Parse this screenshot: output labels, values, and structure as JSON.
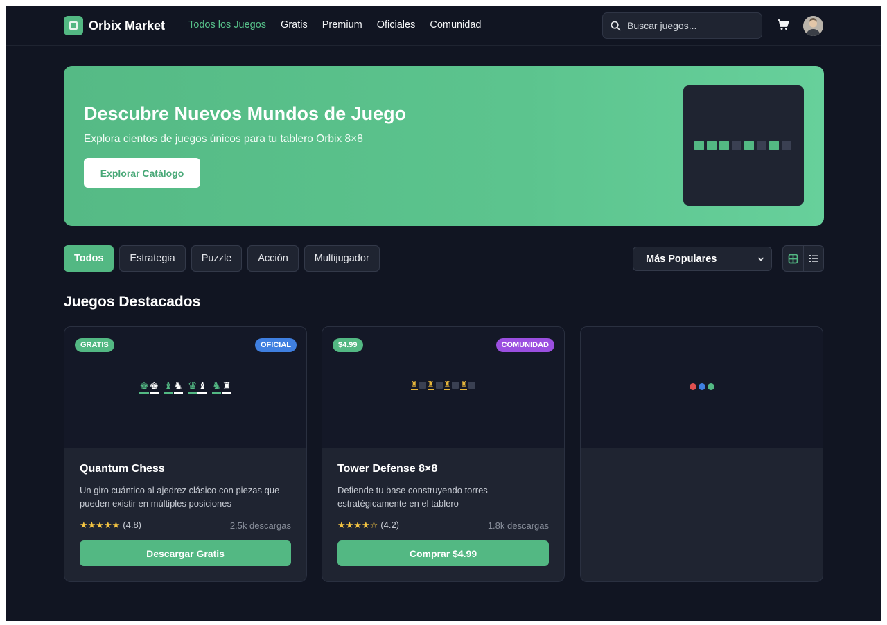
{
  "brand": {
    "name": "Orbix Market",
    "accent": "#53b883"
  },
  "nav": {
    "items": [
      {
        "label": "Todos los Juegos",
        "active": true
      },
      {
        "label": "Gratis",
        "active": false
      },
      {
        "label": "Premium",
        "active": false
      },
      {
        "label": "Oficiales",
        "active": false
      },
      {
        "label": "Comunidad",
        "active": false
      }
    ]
  },
  "search": {
    "placeholder": "Buscar juegos...",
    "value": ""
  },
  "hero": {
    "title": "Descubre Nuevos Mundos de Juego",
    "subtitle": "Explora cientos de juegos únicos para tu tablero Orbix 8×8",
    "button": "Explorar Catálogo",
    "preview_cells": [
      "green",
      "green",
      "green",
      "gray",
      "green",
      "gray",
      "green",
      "gray"
    ]
  },
  "filters": {
    "chips": [
      {
        "label": "Todos",
        "active": true
      },
      {
        "label": "Estrategia",
        "active": false
      },
      {
        "label": "Puzzle",
        "active": false
      },
      {
        "label": "Acción",
        "active": false
      },
      {
        "label": "Multijugador",
        "active": false
      }
    ],
    "sort": {
      "selected": "Más Populares"
    },
    "view": "grid"
  },
  "section": {
    "title": "Juegos Destacados"
  },
  "cards": [
    {
      "price_badge": "GRATIS",
      "price_badge_color": "#53b883",
      "type_badge": "OFICIAL",
      "type_badge_color": "#3f7fe0",
      "title": "Quantum Chess",
      "description": "Un giro cuántico al ajedrez clásico con piezas que pueden existir en múltiples posiciones",
      "stars": "★★★★★",
      "rating": "(4.8)",
      "downloads": "2.5k descargas",
      "button": "Descargar Gratis",
      "preview_pieces": [
        "♚",
        "♚",
        "♝",
        "♞",
        "♛",
        "♝",
        "♞",
        "♜"
      ]
    },
    {
      "price_badge": "$4.99",
      "price_badge_color": "#53b883",
      "type_badge": "COMUNIDAD",
      "type_badge_color": "#9b4fe0",
      "title": "Tower Defense 8×8",
      "description": "Defiende tu base construyendo torres estratégicamente en el tablero",
      "stars": "★★★★☆",
      "rating": "(4.2)",
      "downloads": "1.8k descargas",
      "button": "Comprar $4.99",
      "preview_towers": "♜"
    }
  ],
  "loading_card": {
    "dot_colors": [
      "#e05050",
      "#3f7fe0",
      "#53b883"
    ]
  }
}
